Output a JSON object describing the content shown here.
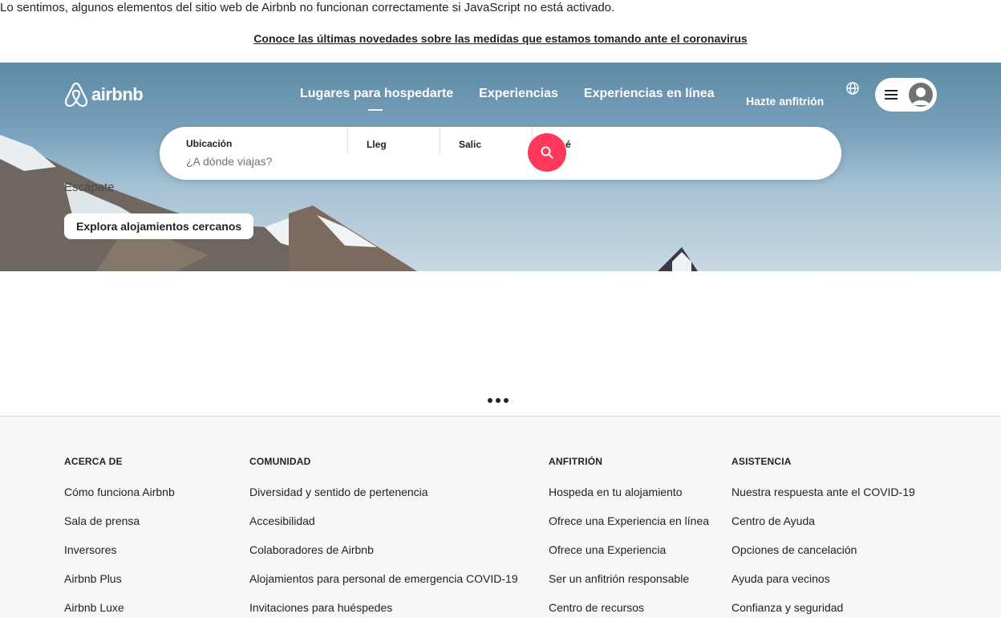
{
  "notice": {
    "nojs": "Lo sentimos, algunos elementos del sitio web de Airbnb no funcionan correctamente si JavaScript no está activado.",
    "covid_link": "Conoce las últimas novedades sobre las medidas que estamos tomando ante el coronavirus"
  },
  "header": {
    "logo_text": "airbnb",
    "nav": [
      {
        "label": "Lugares para hospedarte",
        "active": true
      },
      {
        "label": "Experiencias"
      },
      {
        "label": "Experiencias en línea"
      }
    ],
    "host_label": "Hazte anfitrión",
    "icons": {
      "globe": "globe-icon",
      "menu": "hamburger-menu-icon",
      "avatar": "user-avatar-icon"
    }
  },
  "search": {
    "location_label": "Ubicación",
    "location_placeholder": "¿A dónde viajas?",
    "checkin_label": "Lleg",
    "checkout_label": "Salic",
    "guests_label": "é",
    "button_icon": "search-icon",
    "accent": "#ff385c"
  },
  "hero": {
    "tagline": "Escápate",
    "cta": "Explora alojamientos cercanos"
  },
  "footer": {
    "columns": [
      {
        "title": "ACERCA DE",
        "links": [
          "Cómo funciona Airbnb",
          "Sala de prensa",
          "Inversores",
          "Airbnb Plus",
          "Airbnb Luxe"
        ]
      },
      {
        "title": "COMUNIDAD",
        "links": [
          "Diversidad y sentido de pertenencia",
          "Accesibilidad",
          "Colaboradores de Airbnb",
          "Alojamientos para personal de emergencia COVID-19",
          "Invitaciones para huéspedes"
        ]
      },
      {
        "title": "ANFITRIÓN",
        "links": [
          "Hospeda en tu alojamiento",
          "Ofrece una Experiencia en línea",
          "Ofrece una Experiencia",
          "Ser un anfitrión responsable",
          "Centro de recursos"
        ]
      },
      {
        "title": "ASISTENCIA",
        "links": [
          "Nuestra respuesta ante el COVID-19",
          "Centro de Ayuda",
          "Opciones de cancelación",
          "Ayuda para vecinos",
          "Confianza y seguridad"
        ]
      }
    ]
  }
}
